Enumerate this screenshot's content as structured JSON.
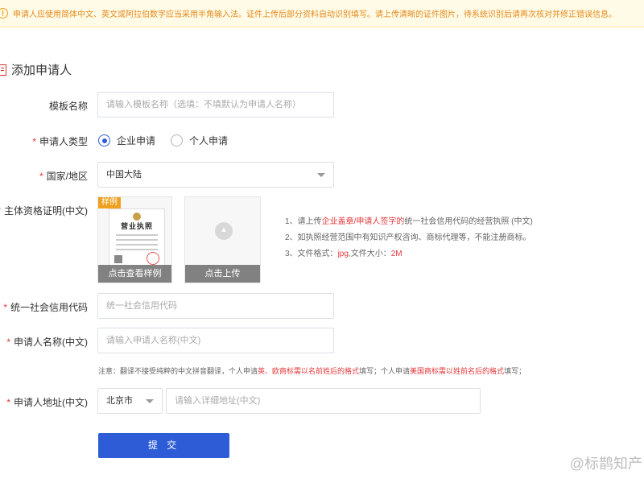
{
  "notice": {
    "text": "申请人应使用简体中文、英文或阿拉伯数字应当采用半角输入法。证件上传后部分资料自动识别填写。请上传清晰的证件图片，待系统识别后请再次核对并修正错误信息。"
  },
  "title": "添加申请人",
  "form": {
    "template_name": {
      "label": "模板名称",
      "placeholder": "请输入模板名称（选填：不填默认为申请人名称）"
    },
    "applicant_type": {
      "label": "申请人类型",
      "options": [
        "企业申请",
        "个人申请"
      ],
      "selected": "企业申请"
    },
    "country": {
      "label": "国家/地区",
      "value": "中国大陆"
    },
    "certificate": {
      "label": "主体资格证明(中文)",
      "sample_badge": "样例",
      "sample_title": "营业执照",
      "sample_button": "点击查看样例",
      "upload_button": "点击上传",
      "hints": {
        "h1_pre": "1、请上传",
        "h1_red": "企业盖章/申请人签字的",
        "h1_post": "统一社会信用代码的经营执照 (中文)",
        "h2": "2、如执照经营范围中有知识产权咨询、商标代理等，不能注册商标。",
        "h3_pre": "3、文件格式：",
        "h3_red1": "jpg",
        "h3_mid": ",文件大小：",
        "h3_red2": "2M"
      }
    },
    "credit_code": {
      "label": "统一社会信用代码",
      "placeholder": "统一社会信用代码"
    },
    "applicant_name": {
      "label": "申请人名称(中文)",
      "placeholder": "请输入申请人名称(中文)"
    },
    "note": {
      "p1": "注意：翻译不接受纯粹的中文拼音翻译，个人申请",
      "r1": "英、欧商标需以名前姓后的格式",
      "p2": "填写；个人申请",
      "r2": "美国商标需以姓前名后的格式",
      "p3": "填写；"
    },
    "address": {
      "label": "申请人地址(中文)",
      "city": "北京市",
      "placeholder": "请输入详细地址(中文)"
    },
    "submit_label": "提 交",
    "required_mark": "*"
  },
  "watermark": "@标鹊知产",
  "colors": {
    "primary": "#2e5cd6",
    "required": "#e4393c",
    "notice_text": "#e58a1f"
  }
}
